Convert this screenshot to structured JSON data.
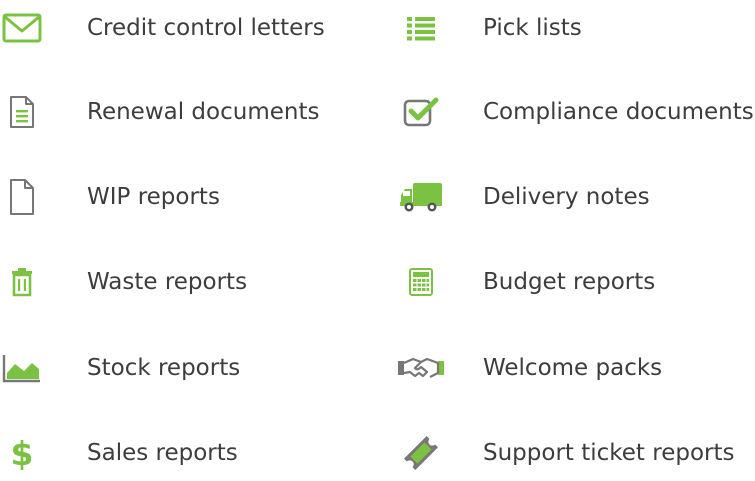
{
  "colors": {
    "text": "#3d3d3d",
    "accent_green": "#7cc242",
    "icon_gray": "#6e6e6e"
  },
  "left_column": [
    {
      "label": "Credit control letters",
      "icon": "envelope-icon"
    },
    {
      "label": "Renewal documents",
      "icon": "document-lines-icon"
    },
    {
      "label": "WIP reports",
      "icon": "blank-document-icon"
    },
    {
      "label": "Waste reports",
      "icon": "trash-icon"
    },
    {
      "label": "Stock reports",
      "icon": "area-chart-icon"
    },
    {
      "label": "Sales reports",
      "icon": "dollar-icon"
    }
  ],
  "right_column": [
    {
      "label": "Pick lists",
      "icon": "list-icon"
    },
    {
      "label": "Compliance documents",
      "icon": "checkbox-icon"
    },
    {
      "label": "Delivery notes",
      "icon": "truck-icon"
    },
    {
      "label": "Budget reports",
      "icon": "calculator-icon"
    },
    {
      "label": "Welcome packs",
      "icon": "handshake-icon"
    },
    {
      "label": "Support ticket reports",
      "icon": "ticket-icon"
    }
  ]
}
